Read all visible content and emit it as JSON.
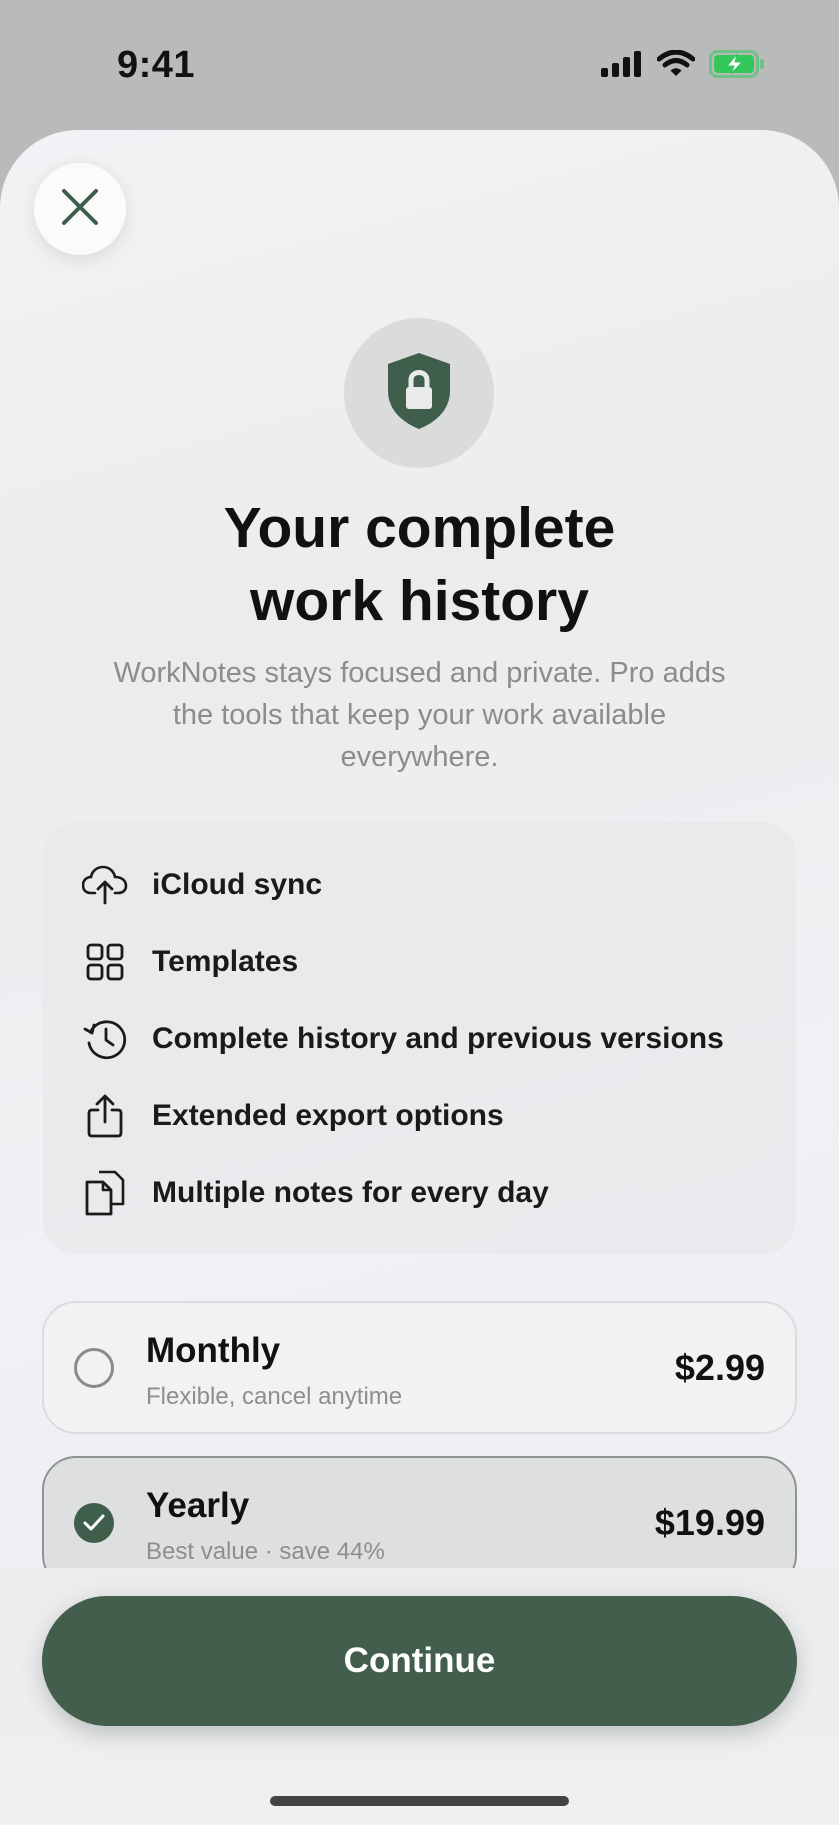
{
  "status_bar": {
    "time": "9:41"
  },
  "hero": {
    "title_line1": "Your complete",
    "title_line2": "work history",
    "subtitle_line1": "WorkNotes stays focused and private. Pro adds",
    "subtitle_line2": "the tools that keep your work available",
    "subtitle_line3": "everywhere."
  },
  "features": [
    {
      "label": "iCloud sync",
      "icon": "icloud-upload-icon"
    },
    {
      "label": "Templates",
      "icon": "grid-icon"
    },
    {
      "label": "Complete history and previous versions",
      "icon": "history-clock-icon"
    },
    {
      "label": "Extended export options",
      "icon": "share-icon"
    },
    {
      "label": "Multiple notes for every day",
      "icon": "documents-icon"
    }
  ],
  "plans": [
    {
      "name": "Monthly",
      "description": "Flexible, cancel anytime",
      "price": "$2.99",
      "selected": false
    },
    {
      "name": "Yearly",
      "description": "Best value · save 44%",
      "price": "$19.99",
      "selected": true
    }
  ],
  "cta": {
    "label": "Continue"
  },
  "colors": {
    "accent": "#435e4d",
    "battery": "#34c759"
  }
}
